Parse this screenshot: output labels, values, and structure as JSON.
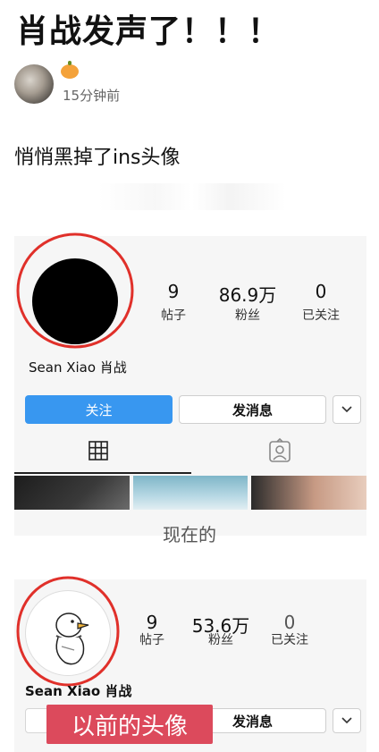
{
  "post": {
    "title": "肖战发声了！！！",
    "time": "15分钟前",
    "body": "悄悄黑掉了ins头像"
  },
  "profile_current": {
    "username": "Sean Xiao 肖战",
    "stats": [
      {
        "value": "9",
        "label": "帖子"
      },
      {
        "value": "86.9万",
        "label": "粉丝"
      },
      {
        "value": "0",
        "label": "已关注"
      }
    ],
    "follow_label": "关注",
    "message_label": "发消息",
    "caption": "现在的"
  },
  "profile_previous": {
    "username": "Sean Xiao 肖战",
    "stats": [
      {
        "value": "9",
        "label": "帖子"
      },
      {
        "value": "53.6万",
        "label": "粉丝"
      },
      {
        "value": "0",
        "label": "已关注"
      }
    ],
    "message_label": "发消息",
    "overlay_label": "以前的头像"
  },
  "icons": {
    "pumpkin": "pumpkin-icon",
    "grid": "grid-icon",
    "tagged": "tagged-icon",
    "dropdown": "chevron-down-icon"
  },
  "colors": {
    "follow_button": "#3897f0",
    "highlight_circle": "#e0302a",
    "overlay_label_bg": "#dc4a5c"
  }
}
